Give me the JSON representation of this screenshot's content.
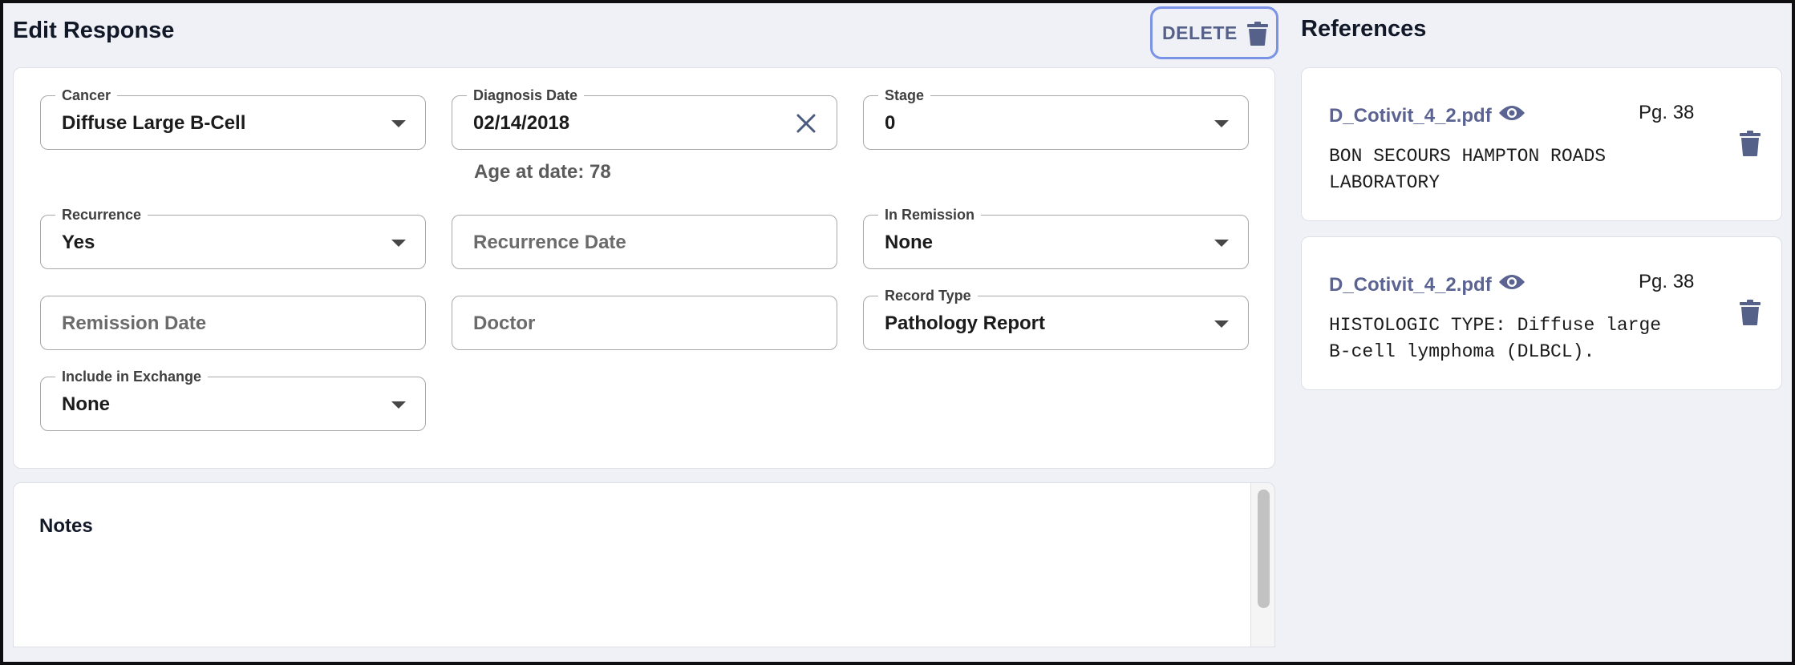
{
  "header": {
    "title": "Edit Response",
    "delete_label": "DELETE"
  },
  "form": {
    "cancer": {
      "label": "Cancer",
      "value": "Diffuse Large B-Cell"
    },
    "diagnosis_date": {
      "label": "Diagnosis Date",
      "value": "02/14/2018",
      "age_text": "Age at date: 78"
    },
    "stage": {
      "label": "Stage",
      "value": "0"
    },
    "recurrence": {
      "label": "Recurrence",
      "value": "Yes"
    },
    "recurrence_date": {
      "placeholder": "Recurrence Date"
    },
    "in_remission": {
      "label": "In Remission",
      "value": "None"
    },
    "remission_date": {
      "placeholder": "Remission Date"
    },
    "doctor": {
      "placeholder": "Doctor"
    },
    "record_type": {
      "label": "Record Type",
      "value": "Pathology Report"
    },
    "include_in_exchange": {
      "label": "Include in Exchange",
      "value": "None"
    }
  },
  "notes": {
    "title": "Notes"
  },
  "references": {
    "title": "References",
    "items": [
      {
        "file": "D_Cotivit_4_2.pdf",
        "page": "Pg. 38",
        "text": "BON SECOURS HAMPTON ROADS\nLABORATORY"
      },
      {
        "file": "D_Cotivit_4_2.pdf",
        "page": "Pg. 38",
        "text": "HISTOLOGIC TYPE: Diffuse large\nB-cell lymphoma (DLBCL)."
      }
    ]
  },
  "colors": {
    "accent": "#7b93e6",
    "link": "#5a6391",
    "background": "#f0f1f6"
  }
}
